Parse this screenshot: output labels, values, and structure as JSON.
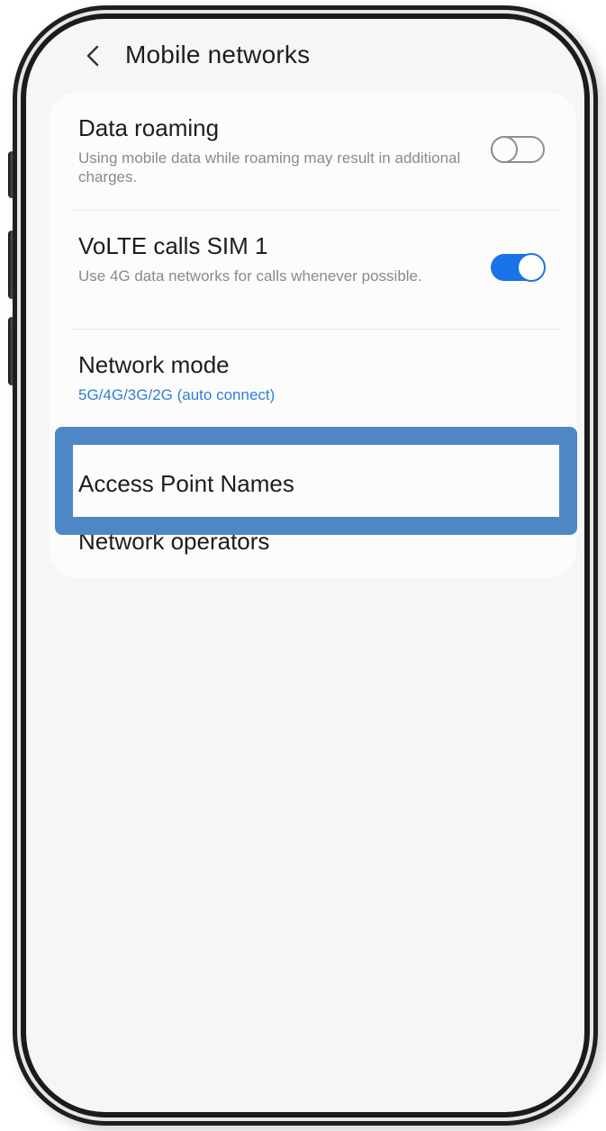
{
  "header": {
    "title": "Mobile networks",
    "back_icon": "chevron-left-icon"
  },
  "settings": {
    "data_roaming": {
      "title": "Data roaming",
      "subtitle": "Using mobile data while roaming may result in additional charges.",
      "enabled": false
    },
    "volte": {
      "title": "VoLTE calls SIM 1",
      "subtitle": "Use 4G data networks for calls whenever possible.",
      "enabled": true
    },
    "network_mode": {
      "title": "Network mode",
      "value": "5G/4G/3G/2G (auto connect)"
    },
    "access_point_names": {
      "title": "Access Point Names",
      "highlighted": true
    },
    "network_operators": {
      "title": "Network operators"
    }
  },
  "colors": {
    "accent": "#1a73e8",
    "link": "#2f7fd6",
    "highlight": "#4f86c6",
    "screen_bg": "#f6f6f6",
    "card_bg": "#fcfcfc"
  }
}
